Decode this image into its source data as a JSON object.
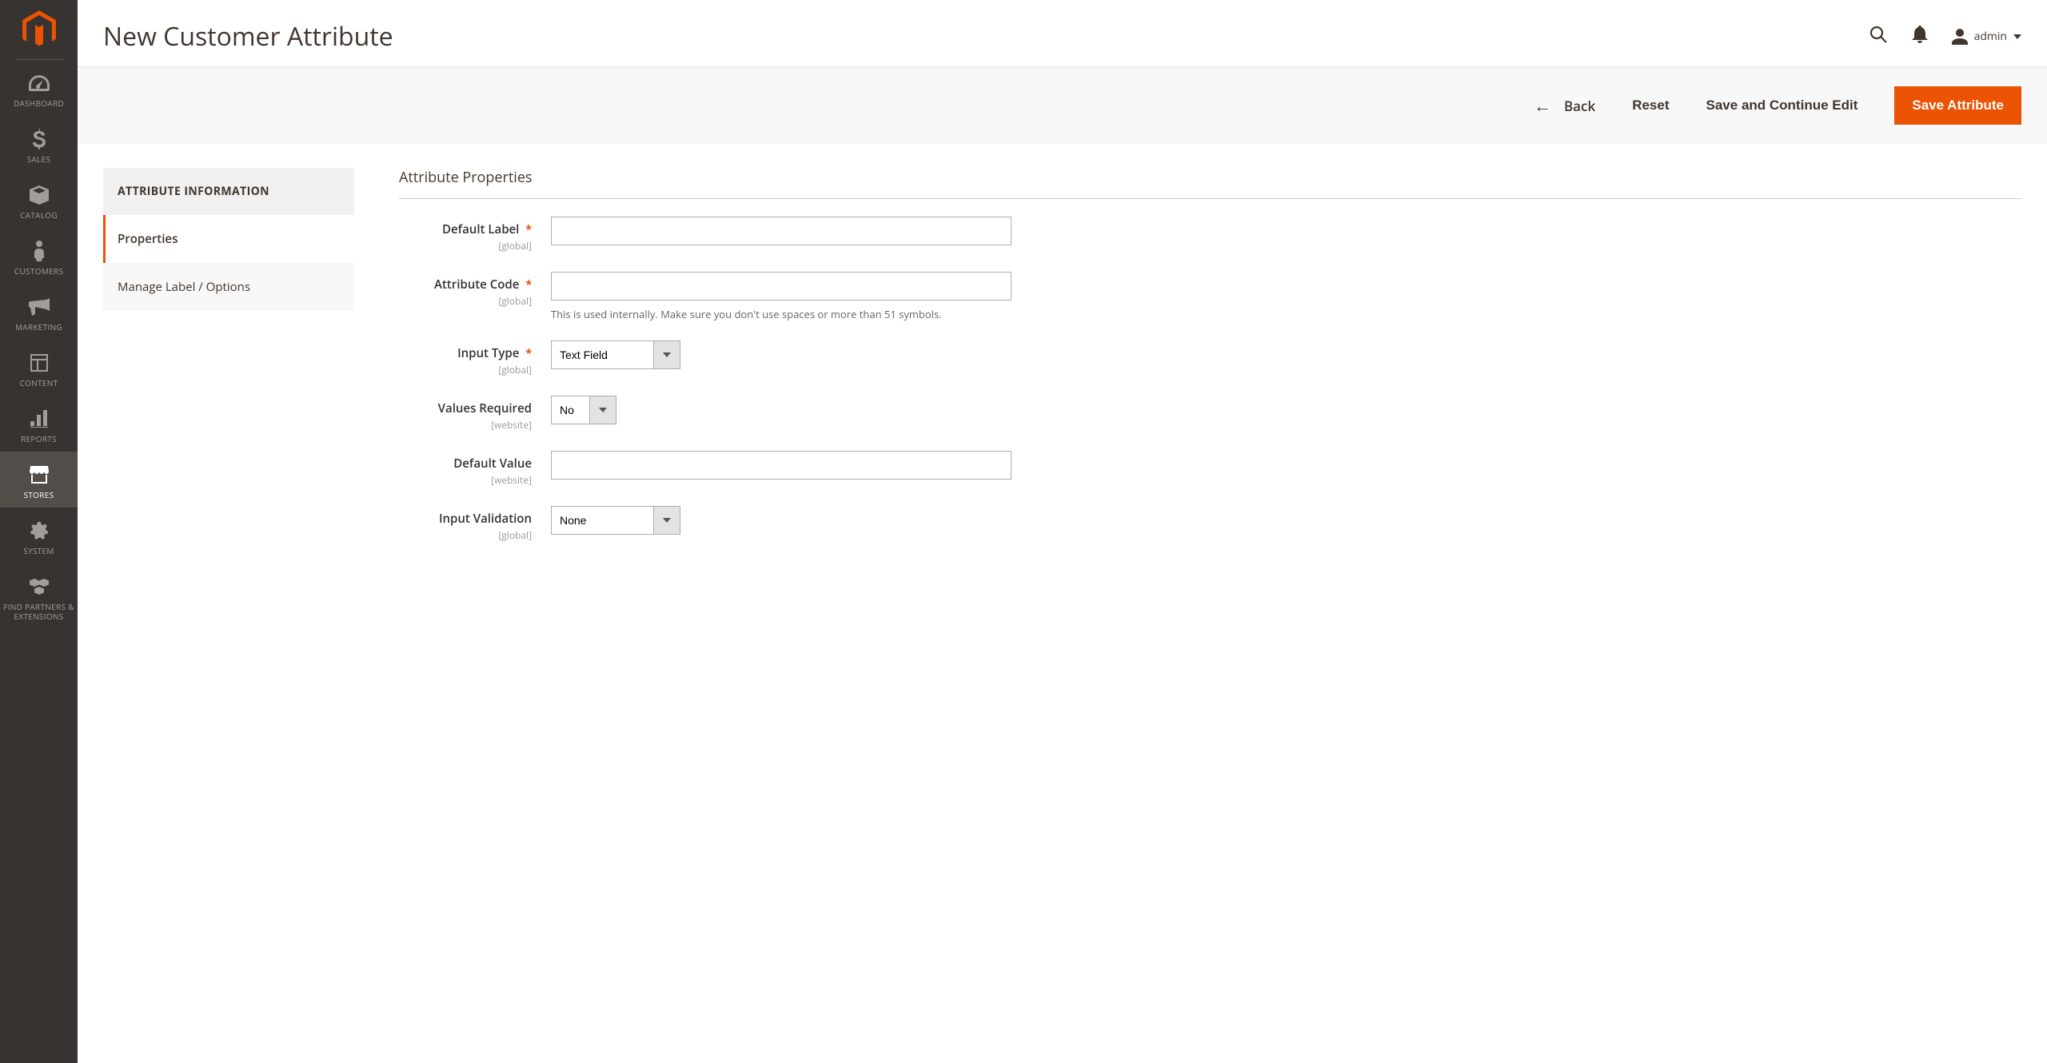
{
  "sidebar": {
    "items": [
      {
        "label": "DASHBOARD"
      },
      {
        "label": "SALES"
      },
      {
        "label": "CATALOG"
      },
      {
        "label": "CUSTOMERS"
      },
      {
        "label": "MARKETING"
      },
      {
        "label": "CONTENT"
      },
      {
        "label": "REPORTS"
      },
      {
        "label": "STORES"
      },
      {
        "label": "SYSTEM"
      },
      {
        "label": "FIND PARTNERS & EXTENSIONS"
      }
    ]
  },
  "page": {
    "title": "New Customer Attribute"
  },
  "header": {
    "user_name": "admin"
  },
  "toolbar": {
    "back_label": "Back",
    "reset_label": "Reset",
    "save_continue_label": "Save and Continue Edit",
    "save_label": "Save Attribute"
  },
  "side_panel": {
    "title": "ATTRIBUTE INFORMATION",
    "tabs": [
      {
        "label": "Properties"
      },
      {
        "label": "Manage Label / Options"
      }
    ]
  },
  "form": {
    "section_title": "Attribute Properties",
    "default_label": {
      "label": "Default Label",
      "scope": "[global]",
      "value": ""
    },
    "attribute_code": {
      "label": "Attribute Code",
      "scope": "[global]",
      "value": "",
      "hint": "This is used internally. Make sure you don't use spaces or more than 51 symbols."
    },
    "input_type": {
      "label": "Input Type",
      "scope": "[global]",
      "value": "Text Field"
    },
    "values_required": {
      "label": "Values Required",
      "scope": "[website]",
      "value": "No"
    },
    "default_value": {
      "label": "Default Value",
      "scope": "[website]",
      "value": ""
    },
    "input_validation": {
      "label": "Input Validation",
      "scope": "[global]",
      "value": "None"
    }
  }
}
